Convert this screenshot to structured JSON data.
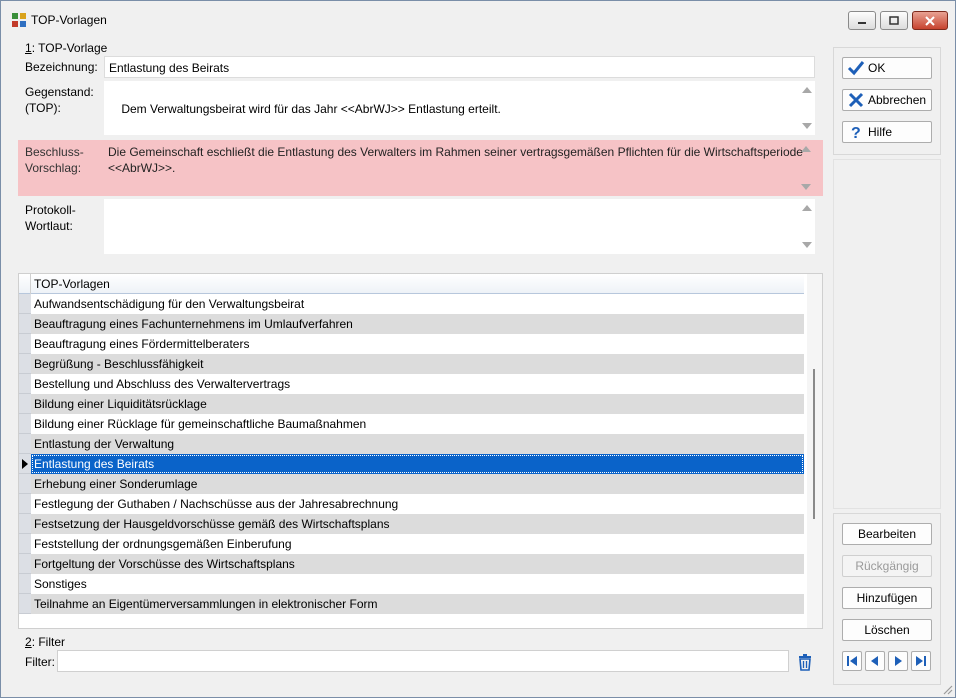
{
  "window": {
    "title": "TOP-Vorlagen"
  },
  "section1": {
    "label_num": "1",
    "label_rest": ": TOP-Vorlage",
    "bezeichnung_label": "Bezeichnung:",
    "bezeichnung_value": "Entlastung des Beirats",
    "gegenstand_label": "Gegenstand:\n(TOP):",
    "gegenstand_value": "Dem Verwaltungsbeirat wird für das Jahr <<AbrWJ>> Entlastung erteilt.",
    "beschluss_label": "Beschluss-\nVorschlag:",
    "beschluss_value": "Die Gemeinschaft eschließt die Entlastung des Verwalters im Rahmen seiner vertragsgemäßen Pflichten für die Wirtschaftsperiode\n<<AbrWJ>>.",
    "protokoll_label": "Protokoll-\nWortlaut:",
    "protokoll_value": ""
  },
  "grid": {
    "header": "TOP-Vorlagen",
    "rows": [
      "Aufwandsentschädigung für den Verwaltungsbeirat",
      "Beauftragung eines Fachunternehmens im Umlaufverfahren",
      "Beauftragung eines Fördermittelberaters",
      "Begrüßung - Beschlussfähigkeit",
      "Bestellung und Abschluss des Verwaltervertrags",
      "Bildung einer Liquiditätsrücklage",
      "Bildung einer Rücklage für gemeinschaftliche Baumaßnahmen",
      "Entlastung der Verwaltung",
      "Entlastung des Beirats",
      "Erhebung einer Sonderumlage",
      "Festlegung der Guthaben / Nachschüsse aus der Jahresabrechnung",
      "Festsetzung der Hausgeldvorschüsse gemäß des Wirtschaftsplans",
      "Feststellung der ordnungsgemäßen Einberufung",
      "Fortgeltung der Vorschüsse des Wirtschaftsplans",
      "Sonstiges",
      "Teilnahme an Eigentümerversammlungen in elektronischer Form"
    ],
    "selected_index": 8
  },
  "section2": {
    "label_num": "2",
    "label_rest": ": Filter",
    "filter_label": "Filter:",
    "filter_value": ""
  },
  "buttons": {
    "ok": "OK",
    "abbrechen": "Abbrechen",
    "hilfe": "Hilfe",
    "bearbeiten": "Bearbeiten",
    "rueckgaengig": "Rückgängig",
    "hinzufuegen": "Hinzufügen",
    "loeschen": "Löschen"
  },
  "colors": {
    "highlight_pink": "#f6c3c6",
    "selection_blue": "#0a63c9",
    "ok_check": "#1d5fb8",
    "cancel_x": "#1d5fb8"
  }
}
